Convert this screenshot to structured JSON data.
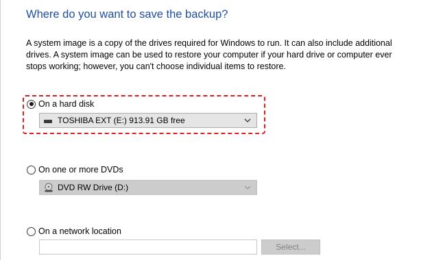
{
  "heading": "Where do you want to save the backup?",
  "description": "A system image is a copy of the drives required for Windows to run. It can also include additional drives. A system image can be used to restore your computer if your hard drive or computer ever stops working; however, you can't choose individual items to restore.",
  "options": {
    "hard_disk": {
      "label": "On a hard disk",
      "selected": true,
      "dropdown_value": "TOSHIBA EXT (E:)  913.91 GB free"
    },
    "dvd": {
      "label": "On one or more DVDs",
      "selected": false,
      "dropdown_value": "DVD RW Drive (D:)"
    },
    "network": {
      "label": "On a network location",
      "selected": false,
      "input_value": "",
      "select_button_label": "Select..."
    }
  },
  "colors": {
    "heading": "#1f4e9d",
    "highlight_border": "#e01b1b"
  },
  "icons": {
    "hard_disk": "hard-drive-icon",
    "dvd": "disc-drive-icon",
    "dropdown": "chevron-down-icon"
  }
}
